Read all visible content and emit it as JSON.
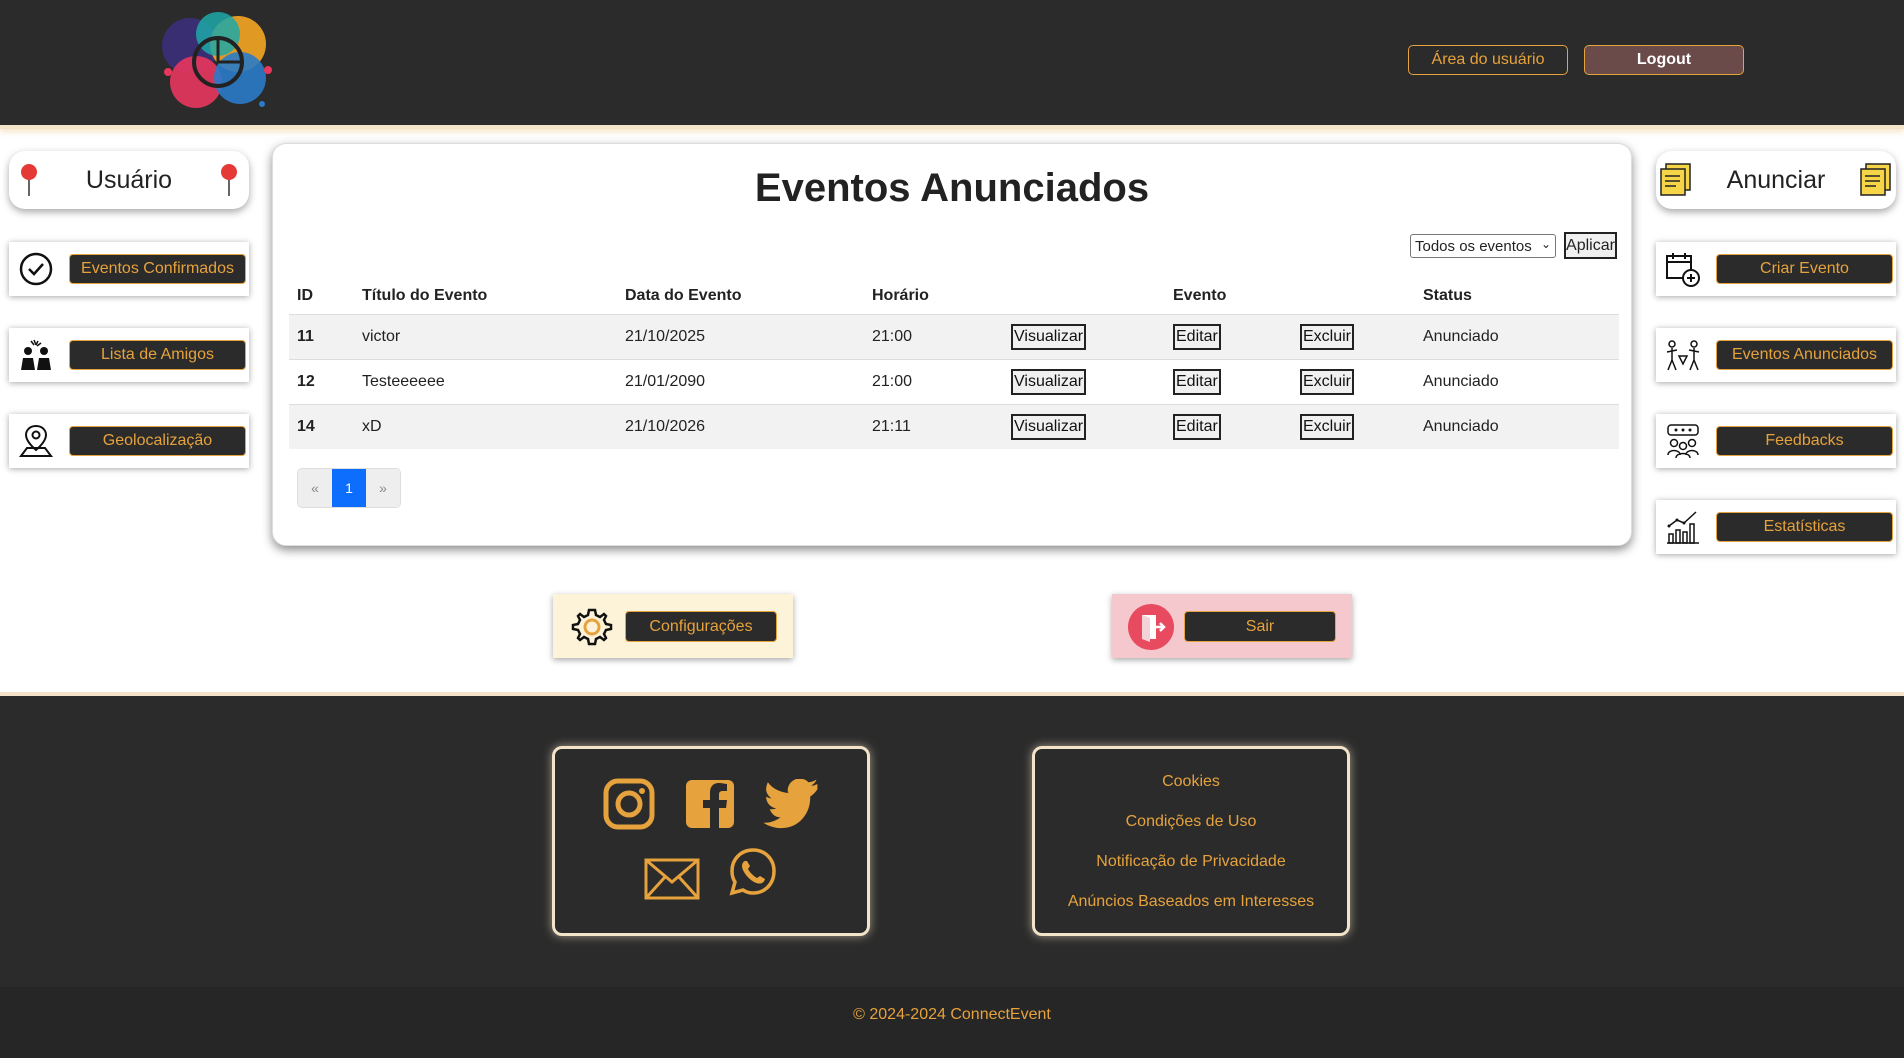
{
  "header": {
    "user_area_label": "Área do usuário",
    "logout_label": "Logout"
  },
  "left_sidebar": {
    "title": "Usuário",
    "items": [
      {
        "label": "Eventos Confirmados",
        "icon": "check-circle-icon"
      },
      {
        "label": "Lista de Amigos",
        "icon": "friends-icon"
      },
      {
        "label": "Geolocalização",
        "icon": "map-pin-icon"
      }
    ]
  },
  "right_sidebar": {
    "title": "Anunciar",
    "items": [
      {
        "label": "Criar Evento",
        "icon": "calendar-add-icon"
      },
      {
        "label": "Eventos Anunciados",
        "icon": "people-icon"
      },
      {
        "label": "Feedbacks",
        "icon": "feedback-icon"
      },
      {
        "label": "Estatísticas",
        "icon": "stats-chart-icon"
      }
    ]
  },
  "main": {
    "title": "Eventos Anunciados",
    "filter_selected": "Todos os eventos",
    "apply_label": "Aplicar",
    "columns": [
      "ID",
      "Título do Evento",
      "Data do Evento",
      "Horário",
      "",
      "Evento",
      "",
      "Status"
    ],
    "rows": [
      {
        "id": "11",
        "title": "victor",
        "date": "21/10/2025",
        "time": "21:00",
        "view": "Visualizar",
        "edit": "Editar",
        "delete": "Excluir",
        "status": "Anunciado"
      },
      {
        "id": "12",
        "title": "Testeeeeee",
        "date": "21/01/2090",
        "time": "21:00",
        "view": "Visualizar",
        "edit": "Editar",
        "delete": "Excluir",
        "status": "Anunciado"
      },
      {
        "id": "14",
        "title": "xD",
        "date": "21/10/2026",
        "time": "21:11",
        "view": "Visualizar",
        "edit": "Editar",
        "delete": "Excluir",
        "status": "Anunciado"
      }
    ],
    "pager": {
      "prev": "«",
      "current": "1",
      "next": "»"
    }
  },
  "actions": {
    "config_label": "Configurações",
    "exit_label": "Sair"
  },
  "footer": {
    "links": [
      "Cookies",
      "Condições de Uso",
      "Notificação de Privacidade",
      "Anúncios Baseados em Interesses"
    ],
    "copyright": "© 2024-2024 ConnectEvent"
  },
  "colors": {
    "dark": "#2b2b2b",
    "accent": "#e6a23c",
    "primary": "#0d6efd"
  }
}
